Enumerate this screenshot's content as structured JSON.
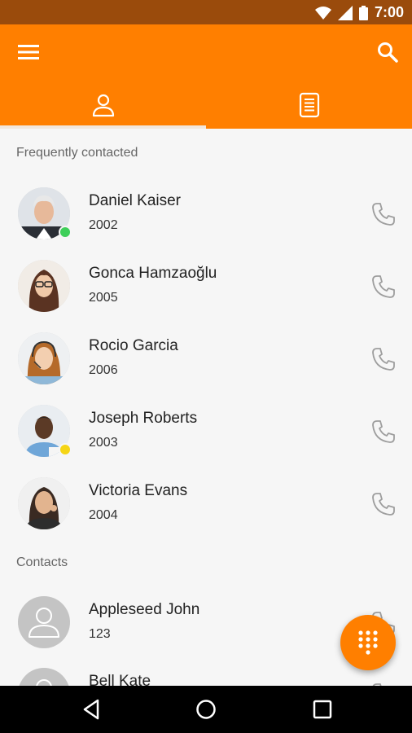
{
  "status_bar": {
    "time": "7:00",
    "icons": [
      "wifi-icon",
      "signal-icon",
      "battery-icon"
    ]
  },
  "app_bar": {
    "menu_icon": "menu-icon",
    "search_icon": "search-icon",
    "tabs": [
      {
        "name": "contacts-tab",
        "icon": "person-icon",
        "selected": true
      },
      {
        "name": "history-tab",
        "icon": "list-icon",
        "selected": false
      }
    ]
  },
  "sections": {
    "frequent": "Frequently contacted",
    "contacts": "Contacts"
  },
  "frequent": [
    {
      "name": "Daniel Kaiser",
      "ext": "2002",
      "presence": "online",
      "presence_color": "#3ecf5a"
    },
    {
      "name": "Gonca Hamzaoğlu",
      "ext": "2005",
      "presence": "",
      "presence_color": ""
    },
    {
      "name": "Rocio Garcia",
      "ext": "2006",
      "presence": "",
      "presence_color": ""
    },
    {
      "name": "Joseph Roberts",
      "ext": "2003",
      "presence": "away",
      "presence_color": "#f5d515"
    },
    {
      "name": "Victoria Evans",
      "ext": "2004",
      "presence": "",
      "presence_color": ""
    }
  ],
  "contacts": [
    {
      "name": "Appleseed John",
      "ext": "123"
    },
    {
      "name": "Bell Kate",
      "ext": ""
    }
  ],
  "colors": {
    "accent": "#ff7f00",
    "status_bar": "#9a4b0c",
    "background": "#f6f6f6"
  }
}
